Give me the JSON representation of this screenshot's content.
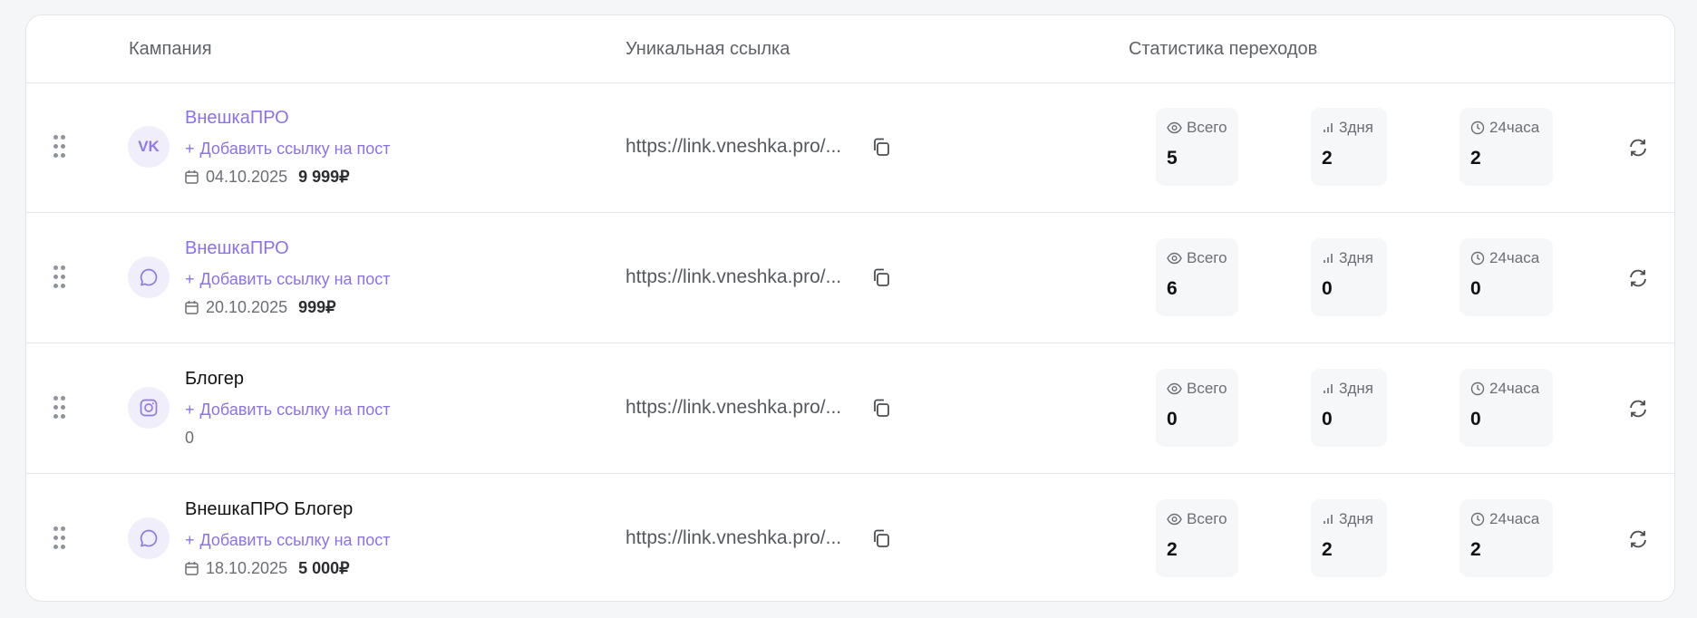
{
  "table": {
    "headers": {
      "campaign": "Кампания",
      "unique_link": "Уникальная ссылка",
      "stats": "Статистика переходов"
    },
    "stat_labels": {
      "total": "Всего",
      "three_days": "3дня",
      "day": "24часа"
    },
    "add_link_label": "Добавить ссылку на пост",
    "rows": [
      {
        "avatar": "VK",
        "avatar_icon": "vk-logo",
        "name": "ВнешкаПРО",
        "date": "04.10.2025",
        "price": "9 999₽",
        "url": "https://link.vneshka.pro/...",
        "total": "5",
        "three_days": "2",
        "day": "2"
      },
      {
        "avatar": "",
        "avatar_icon": "chat-bubble-icon",
        "name": "ВнешкаПРО",
        "date": "20.10.2025",
        "price": "999₽",
        "url": "https://link.vneshka.pro/...",
        "total": "6",
        "three_days": "0",
        "day": "0"
      },
      {
        "avatar": "",
        "avatar_icon": "instagram-icon",
        "name": "Блогер",
        "date": "",
        "price": "0",
        "url": "https://link.vneshka.pro/...",
        "total": "0",
        "three_days": "0",
        "day": "0"
      },
      {
        "avatar": "",
        "avatar_icon": "chat-bubble-icon",
        "name": "ВнешкаПРО Блогер",
        "date": "18.10.2025",
        "price": "5 000₽",
        "url": "https://link.vneshka.pro/...",
        "total": "2",
        "three_days": "2",
        "day": "2"
      }
    ]
  },
  "colors": {
    "accent": "#8b72e8",
    "avatar_bg": "#f1eefc",
    "stat_bg": "#f6f7f9",
    "border": "#e6e7ea"
  }
}
